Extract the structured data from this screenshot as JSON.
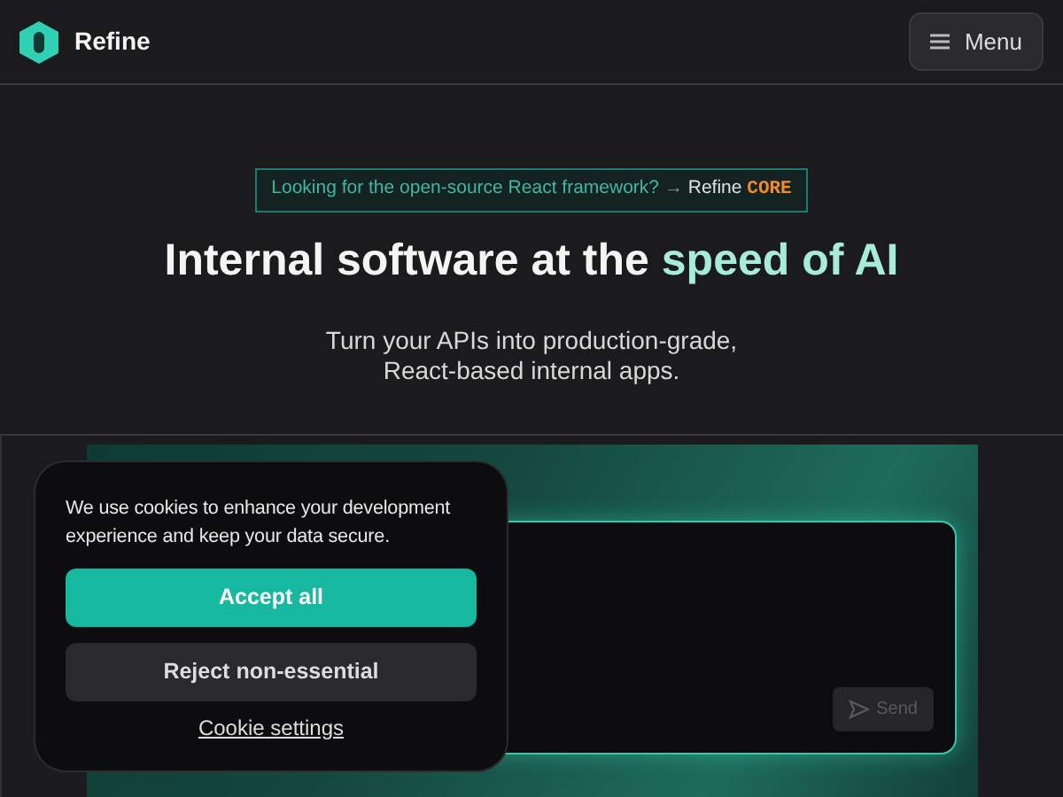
{
  "header": {
    "brand": "Refine",
    "menu_button": "Menu"
  },
  "banner": {
    "text": "Looking for the open-source React framework?",
    "arrow": "→",
    "product": "Refine",
    "product_tag": "CORE"
  },
  "hero": {
    "title": "Internal software at the ",
    "title_highlight": "speed of AI",
    "subtitle": "Turn your APIs into production-grade,\nReact-based internal apps."
  },
  "demo": {
    "send_button": {
      "label": "Send",
      "disabled": true
    }
  },
  "cookie_popup": {
    "message": "We use cookies to enhance your development experience and keep your data secure.",
    "accept": "Accept all",
    "reject": "Reject non-essential",
    "settings": "Cookie settings"
  }
}
